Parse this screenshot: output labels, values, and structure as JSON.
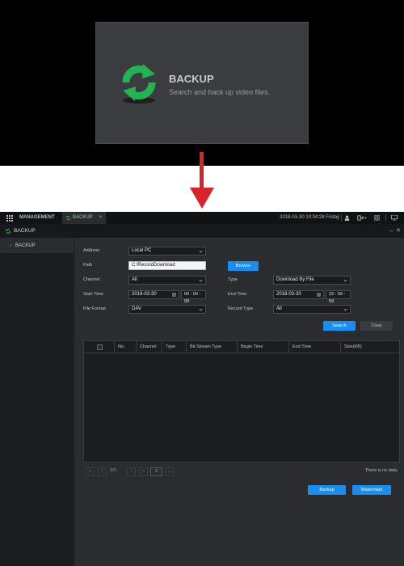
{
  "hero": {
    "title": "BACKUP",
    "subtitle": "Search and back up video files.",
    "icon": "refresh-icon"
  },
  "colors": {
    "accent_blue": "#1a8ef0",
    "icon_green": "#22b452",
    "arrow_red": "#d8232a"
  },
  "topbar": {
    "management": "MANAGEMENT",
    "tab_label": "BACKUP",
    "datetime": "2018-03-30 10:04:28 Friday"
  },
  "window": {
    "title": "BACKUP"
  },
  "sidebar": {
    "items": [
      {
        "label": "BACKUP"
      }
    ]
  },
  "form": {
    "address_label": "Address",
    "address_value": "Local PC",
    "path_label": "Path",
    "path_value": "C:\\RecordDownload",
    "browse_label": "Browse",
    "channel_label": "Channel",
    "channel_value": "All",
    "type_label": "Type",
    "type_value": "Download By File",
    "start_label": "Start Time",
    "start_date": "2018-03-30",
    "start_time": "00 : 00 : 00",
    "end_label": "End Time",
    "end_date": "2018-03-30",
    "end_time": "23 : 59 : 59",
    "format_label": "File Format",
    "format_value": "DAV",
    "record_label": "Record Type",
    "record_value": "All",
    "search_label": "Search",
    "clear_label": "Clear"
  },
  "table": {
    "columns": [
      "No.",
      "Channel",
      "Type",
      "Bit Stream Type",
      "Begin Time",
      "End Time",
      "Size(KB)"
    ],
    "rows": []
  },
  "pager": {
    "page_count": "0/0",
    "page_input": "0",
    "status": "There is no data."
  },
  "actions": {
    "backup_label": "Backup",
    "watermark_label": "Watermark"
  }
}
